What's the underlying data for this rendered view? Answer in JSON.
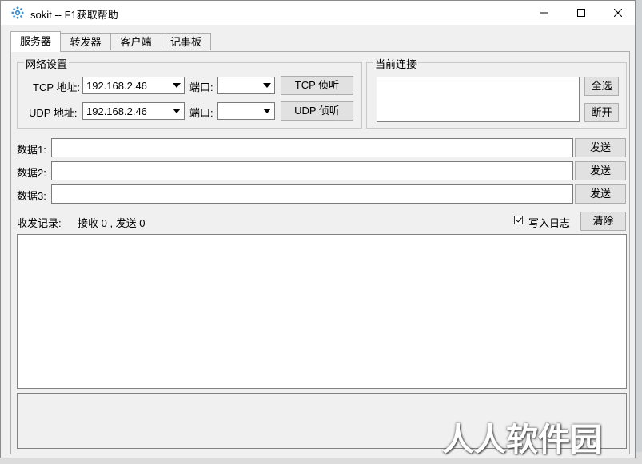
{
  "window": {
    "title": "sokit -- F1获取帮助"
  },
  "tabs": [
    {
      "label": "服务器",
      "active": true
    },
    {
      "label": "转发器",
      "active": false
    },
    {
      "label": "客户端",
      "active": false
    },
    {
      "label": "记事板",
      "active": false
    }
  ],
  "network": {
    "group_title": "网络设置",
    "tcp": {
      "label": "TCP 地址:",
      "address": "192.168.2.46",
      "port_label": "端口:",
      "port": "",
      "button": "TCP 侦听"
    },
    "udp": {
      "label": "UDP 地址:",
      "address": "192.168.2.46",
      "port_label": "端口:",
      "port": "",
      "button": "UDP 侦听"
    }
  },
  "connections": {
    "group_title": "当前连接",
    "select_all": "全选",
    "disconnect": "断开"
  },
  "data_rows": [
    {
      "label": "数据1:",
      "value": "",
      "button": "发送"
    },
    {
      "label": "数据2:",
      "value": "",
      "button": "发送"
    },
    {
      "label": "数据3:",
      "value": "",
      "button": "发送"
    }
  ],
  "log": {
    "label": "收发记录:",
    "stats": "接收 0 , 发送 0",
    "write_log_label": "写入日志",
    "write_log_checked": true,
    "clear_button": "清除"
  },
  "watermark": "人人软件园",
  "icons": {
    "app": "gear-icon",
    "minimize": "minimize-icon",
    "maximize": "maximize-icon",
    "close": "close-icon"
  },
  "colors": {
    "window_bg": "#f0f0f0",
    "titlebar_bg": "#ffffff",
    "app_icon": "#3b8fd6"
  }
}
